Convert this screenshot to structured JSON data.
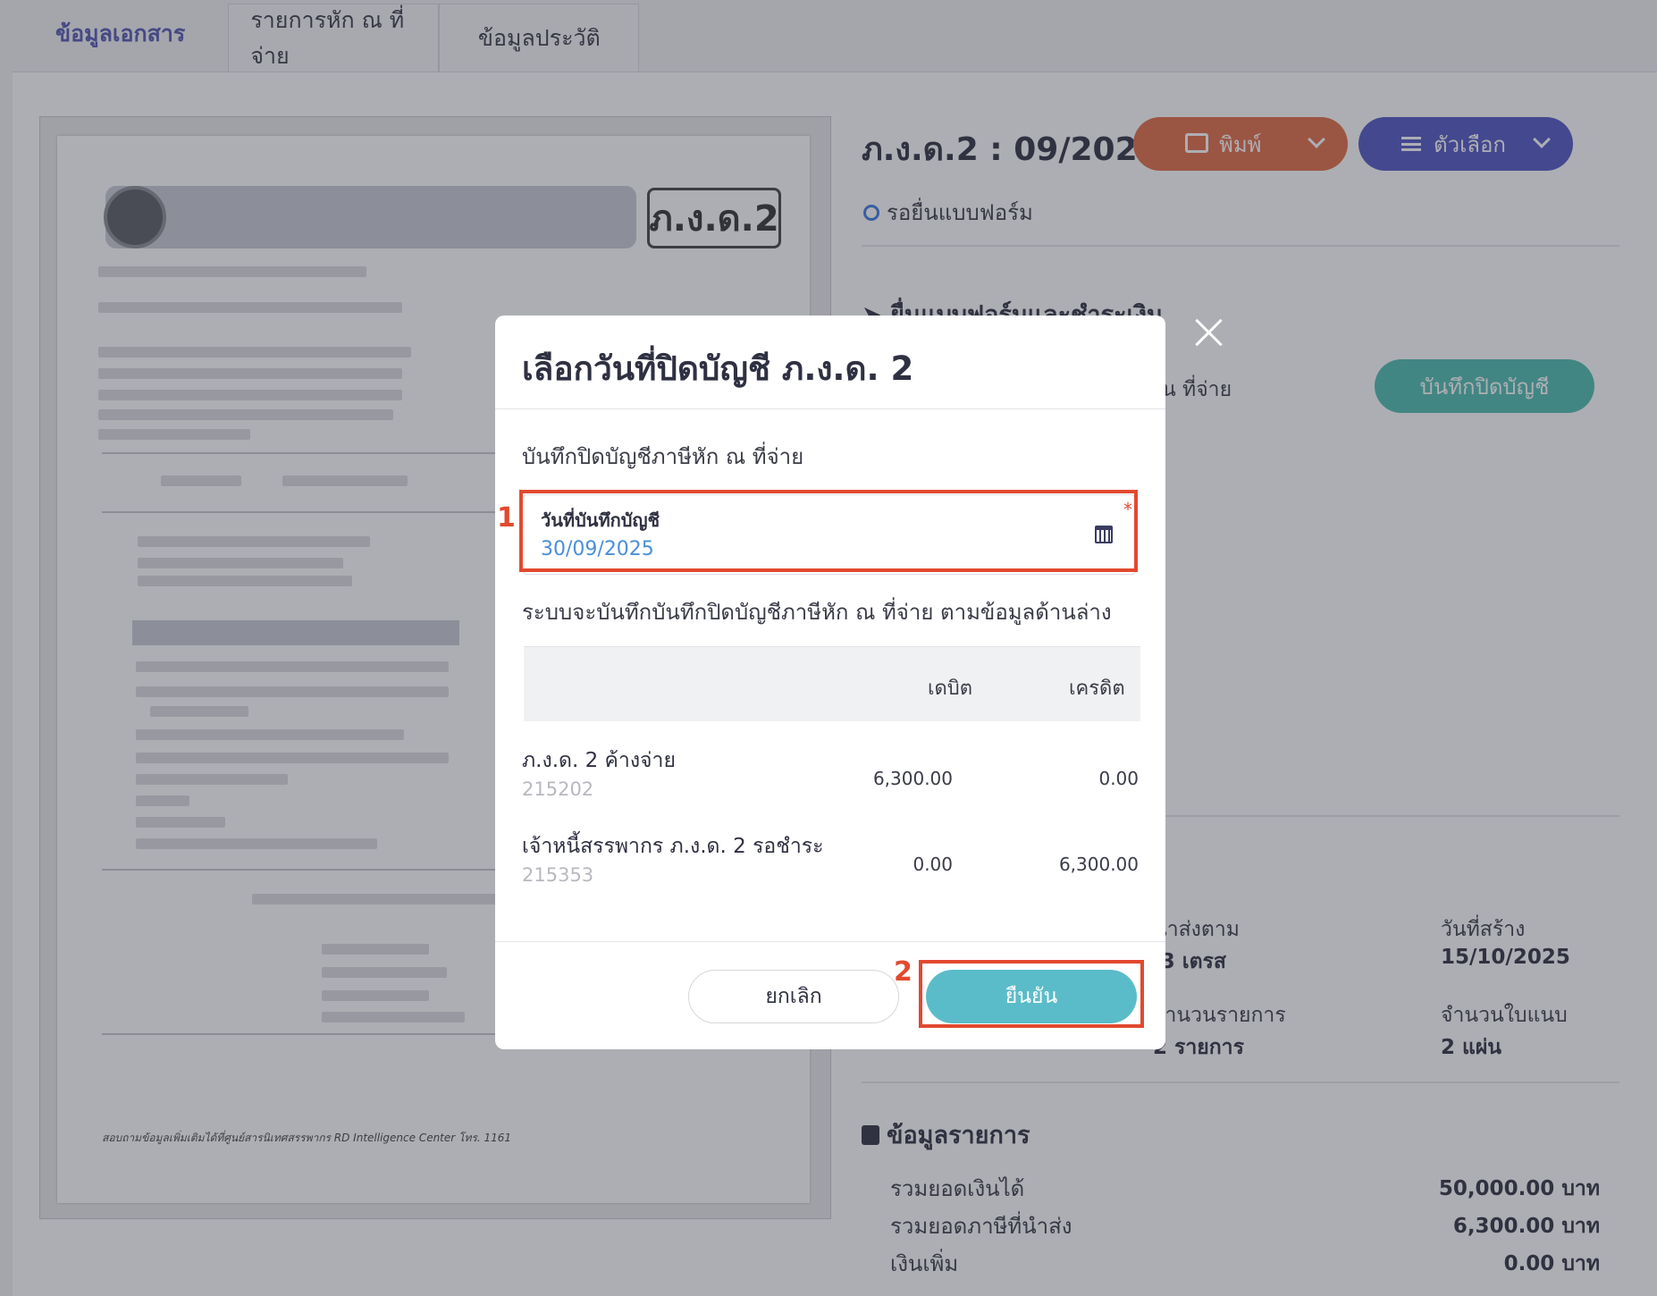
{
  "tabs": [
    {
      "label": "ข้อมูลเอกสาร"
    },
    {
      "label": "รายการหัก ณ ที่จ่าย"
    },
    {
      "label": "ข้อมูลประวัติ"
    }
  ],
  "doc_preview": {
    "form_badge": "ภ.ง.ด.2",
    "footer": "สอบถามข้อมูลเพิ่มเติมได้ที่ศูนย์สารนิเทศสรรพากร RD Intelligence Center โทร. 1161"
  },
  "header": {
    "form_code": "ภ.ง.ด.2 : 09/2025",
    "print_label": "พิมพ์",
    "options_label": "ตัวเลือก",
    "status": "รอยื่นแบบฟอร์ม"
  },
  "submit_section": {
    "title": "ยื่นแบบฟอร์มและชำระเงิน",
    "row_text": "น ที่จ่าย",
    "save_button": "บันทึกปิดบัญชี"
  },
  "info": {
    "label1": "นำส่งตาม",
    "value1": ".3 เตรส",
    "label2": "วันที่สร้าง",
    "value2": "15/10/2025",
    "label3": "จำนวนรายการ",
    "value3": "2 รายการ",
    "label4": "จำนวนใบแนบ",
    "value4": "2 แผ่น"
  },
  "summary": {
    "title": "ข้อมูลรายการ",
    "rows": [
      {
        "label": "รวมยอดเงินได้",
        "value": "50,000.00 บาท"
      },
      {
        "label": "รวมยอดภาษีที่นำส่ง",
        "value": "6,300.00 บาท"
      },
      {
        "label": "เงินเพิ่ม",
        "value": "0.00 บาท"
      }
    ]
  },
  "modal": {
    "title": "เลือกวันที่ปิดบัญชี ภ.ง.ด. 2",
    "subtitle": "บันทึกปิดบัญชีภาษีหัก ณ ที่จ่าย",
    "date_label": "วันที่บันทึกบัญชี",
    "date_value": "30/09/2025",
    "required_mark": "*",
    "note": "ระบบจะบันทึกบันทึกปิดบัญชีภาษีหัก ณ ที่จ่าย ตามข้อมูลด้านล่าง",
    "columns": {
      "debit": "เดบิต",
      "credit": "เครดิต"
    },
    "rows": [
      {
        "name": "ภ.ง.ด. 2 ค้างจ่าย",
        "code": "215202",
        "debit": "6,300.00",
        "credit": "0.00"
      },
      {
        "name": "เจ้าหนี้สรรพากร ภ.ง.ด. 2 รอชำระ",
        "code": "215353",
        "debit": "0.00",
        "credit": "6,300.00"
      }
    ],
    "cancel_label": "ยกเลิก",
    "confirm_label": "ยืนยัน"
  },
  "annotations": {
    "step1": "1",
    "step2": "2"
  },
  "colors": {
    "accent": "#5055c3",
    "print": "#e26b45",
    "confirm": "#5bbcc9",
    "highlight": "#e2492f"
  }
}
